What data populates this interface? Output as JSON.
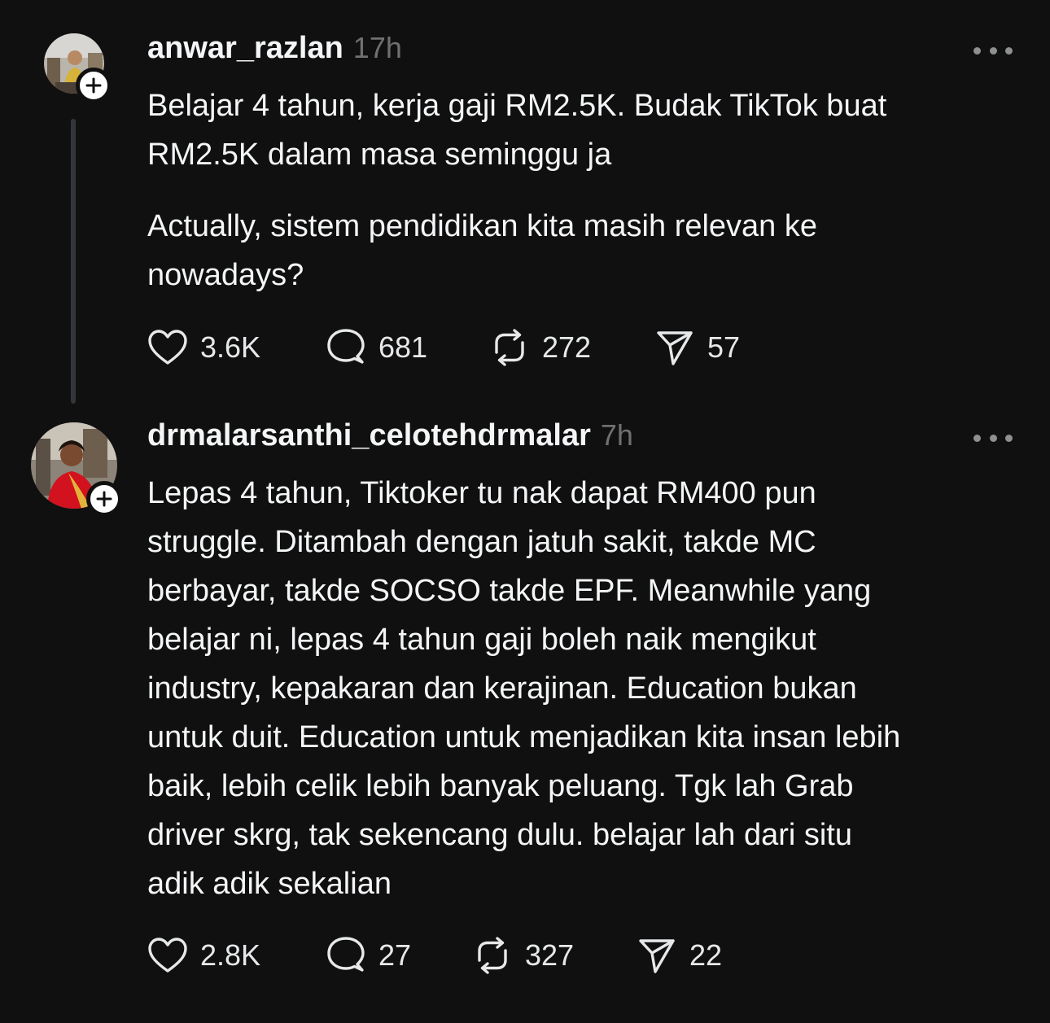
{
  "posts": [
    {
      "username": "anwar_razlan",
      "time": "17h",
      "paragraphs": [
        [
          "Belajar 4 tahun, kerja gaji RM2.5K. Budak TikTok buat",
          "RM2.5K dalam masa seminggu ja"
        ],
        [
          "Actually, sistem pendidikan kita masih relevan ke",
          "nowadays?"
        ]
      ],
      "likes": "3.6K",
      "replies": "681",
      "reposts": "272",
      "shares": "57"
    },
    {
      "username": "drmalarsanthi_celotehdrmalar",
      "time": "7h",
      "paragraphs": [
        [
          "Lepas 4 tahun, Tiktoker tu nak dapat RM400 pun",
          "struggle. Ditambah dengan jatuh sakit, takde MC",
          "berbayar, takde SOCSO takde EPF. Meanwhile yang",
          "belajar ni, lepas 4 tahun gaji boleh naik mengikut",
          "industry, kepakaran dan kerajinan. Education bukan",
          "untuk duit. Education untuk menjadikan kita insan lebih",
          "baik, lebih celik lebih banyak peluang. Tgk lah Grab",
          "driver skrg, tak sekencang dulu. belajar lah dari situ",
          "adik adik sekalian"
        ]
      ],
      "likes": "2.8K",
      "replies": "27",
      "reposts": "327",
      "shares": "22"
    }
  ],
  "icons": {
    "like": "heart-icon",
    "reply": "speech-bubble-icon",
    "repost": "repost-arrows-icon",
    "share": "paper-plane-icon",
    "more": "more-dots-icon",
    "follow": "plus-icon"
  },
  "colors": {
    "background": "#101010",
    "text": "#f3f5f7",
    "muted": "#6f7072",
    "thread_line": "#333638"
  }
}
